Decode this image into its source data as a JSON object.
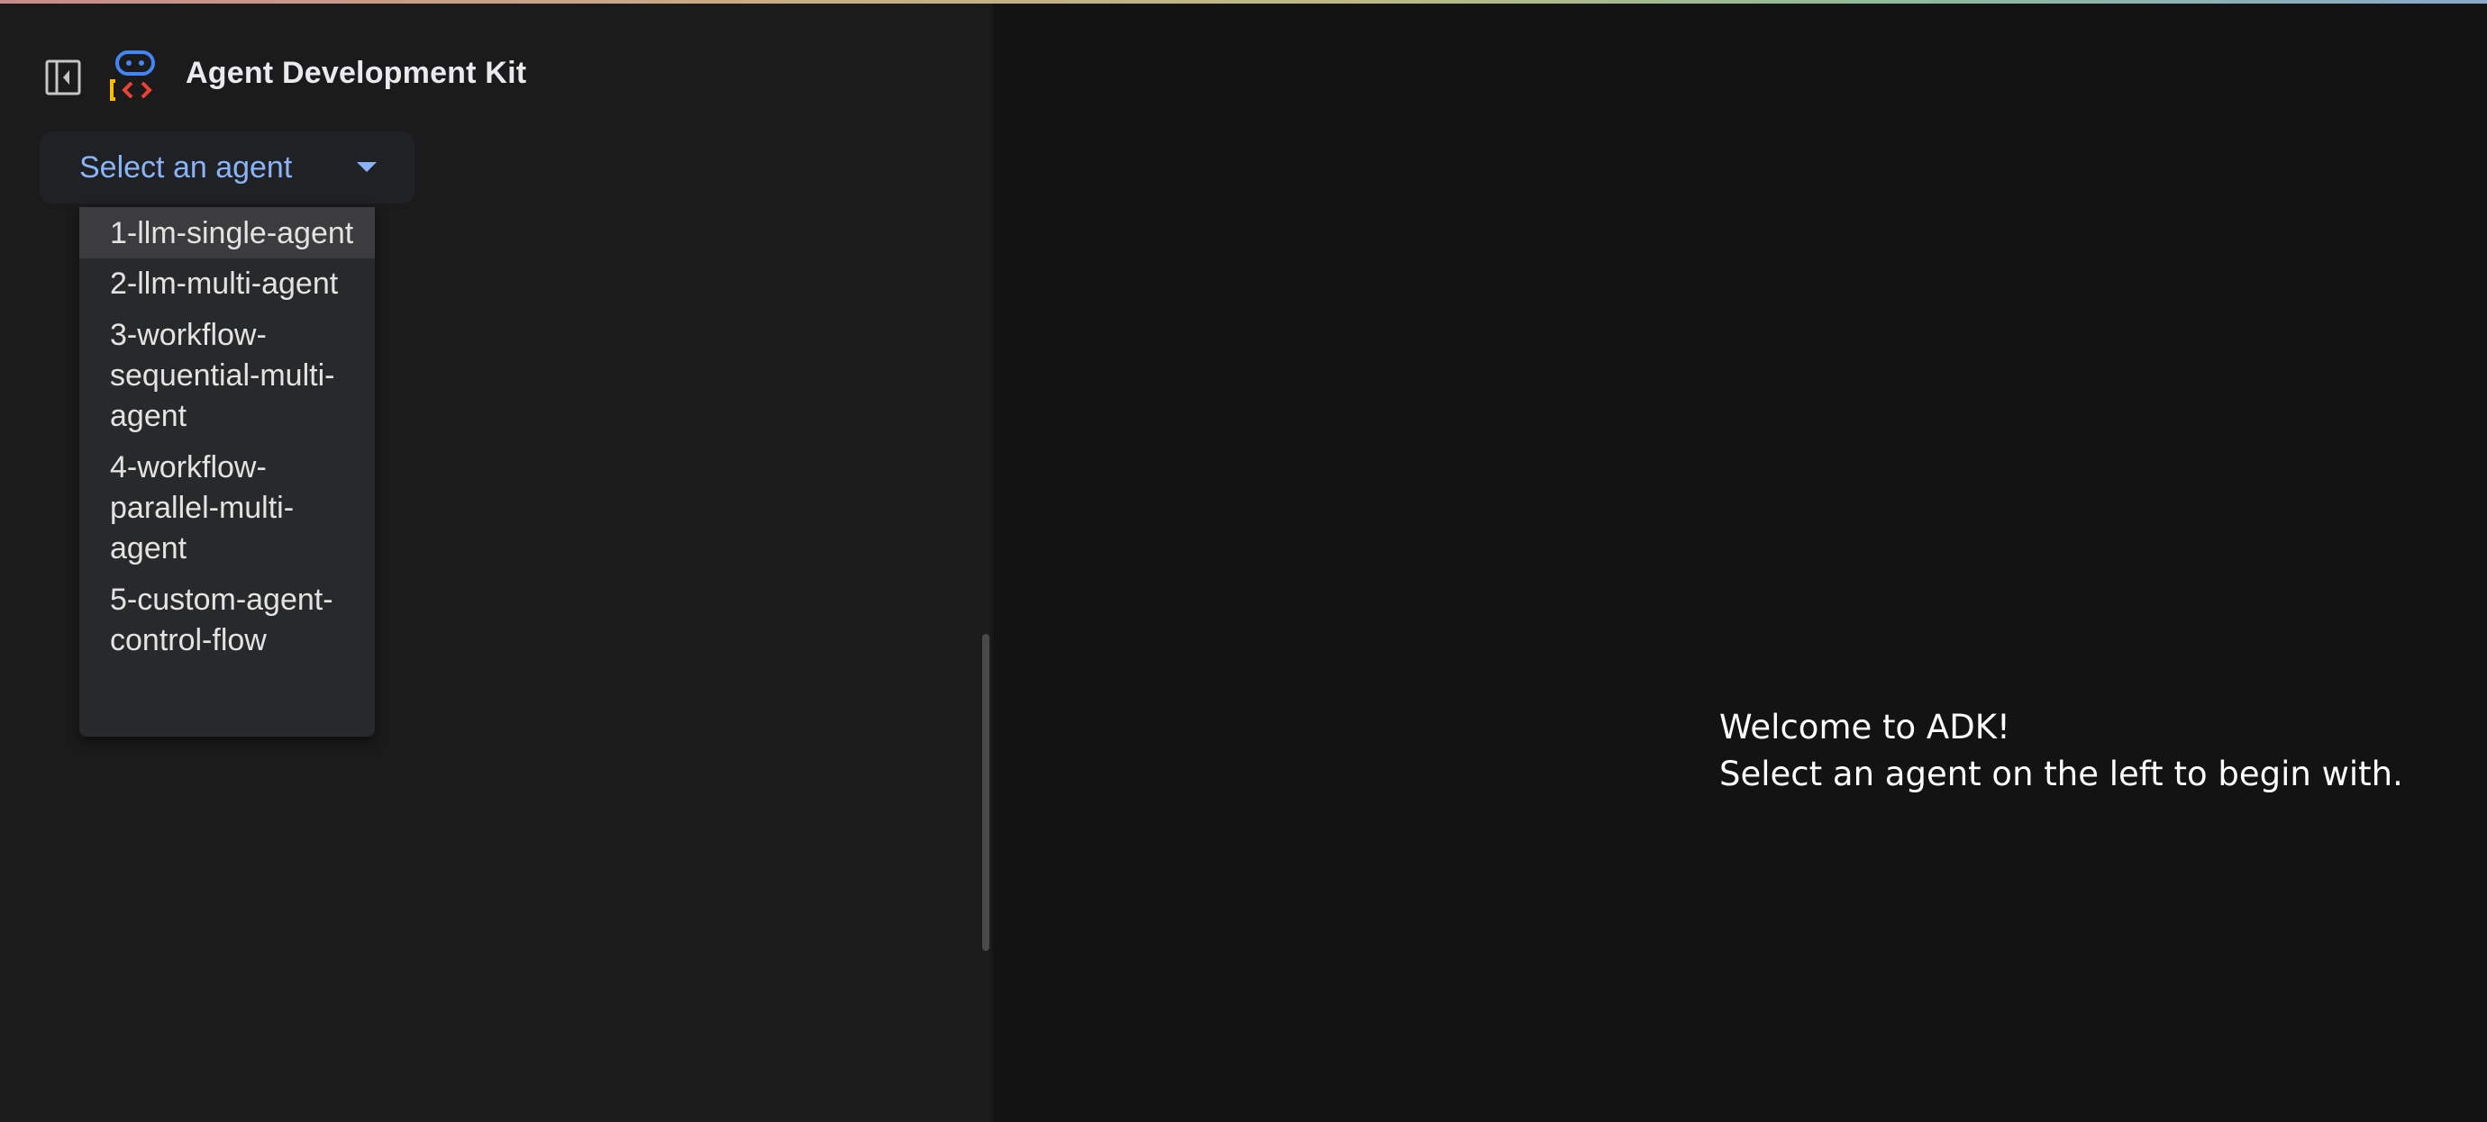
{
  "app": {
    "title": "Agent Development Kit"
  },
  "icons": {
    "sidebar_toggle": "left-panel-close-icon",
    "logo": "adk-robot-logo-icon",
    "dropdown_caret": "caret-down-icon"
  },
  "colors": {
    "accent": "#8ab4f8",
    "sidebar_bg": "#1b1b1c",
    "main_bg": "#131314",
    "option_selected_bg": "#3c3b3d"
  },
  "agent_select": {
    "placeholder": "Select an agent",
    "options": [
      {
        "label": "1-llm-single-agent",
        "highlighted": true
      },
      {
        "label": "2-llm-multi-agent",
        "highlighted": false
      },
      {
        "label": "3-workflow-sequential-multi-agent",
        "highlighted": false
      },
      {
        "label": "4-workflow-parallel-multi-agent",
        "highlighted": false
      },
      {
        "label": "5-custom-agent-control-flow",
        "highlighted": false
      }
    ]
  },
  "main": {
    "welcome_line1": "Welcome to ADK!",
    "welcome_line2": "Select an agent on the left to begin with."
  }
}
